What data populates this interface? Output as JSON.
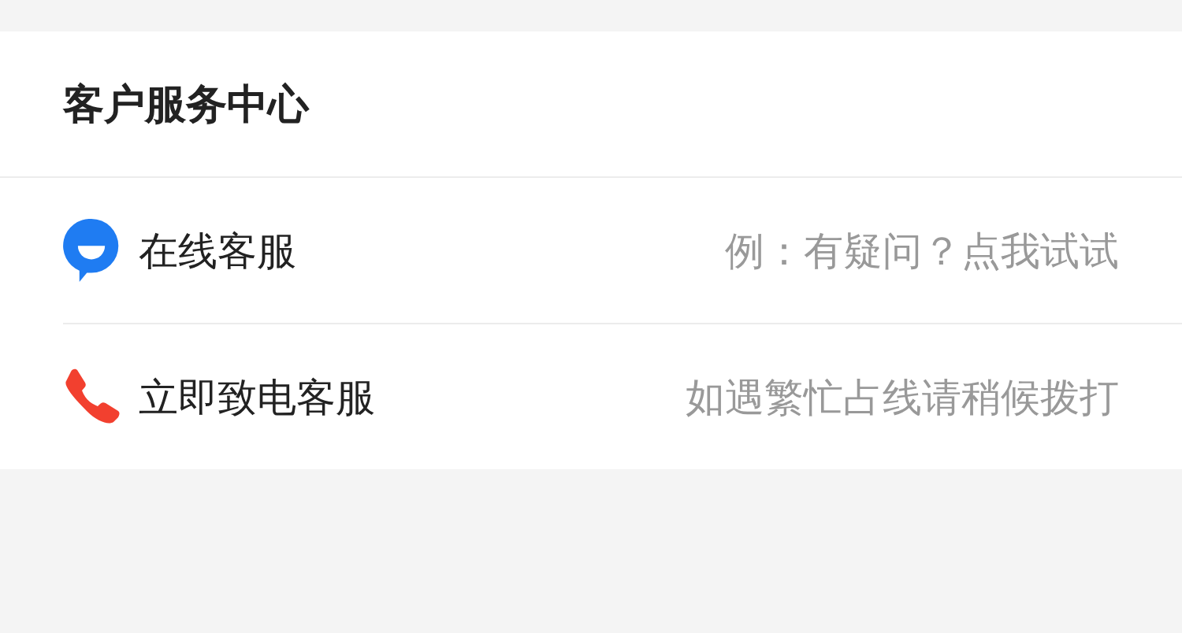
{
  "title": "客户服务中心",
  "items": [
    {
      "kind": "chat",
      "label": "在线客服",
      "hint": "例：有疑问？点我试试"
    },
    {
      "kind": "phone",
      "label": "立即致电客服",
      "hint": "如遇繁忙占线请稍候拨打"
    }
  ]
}
